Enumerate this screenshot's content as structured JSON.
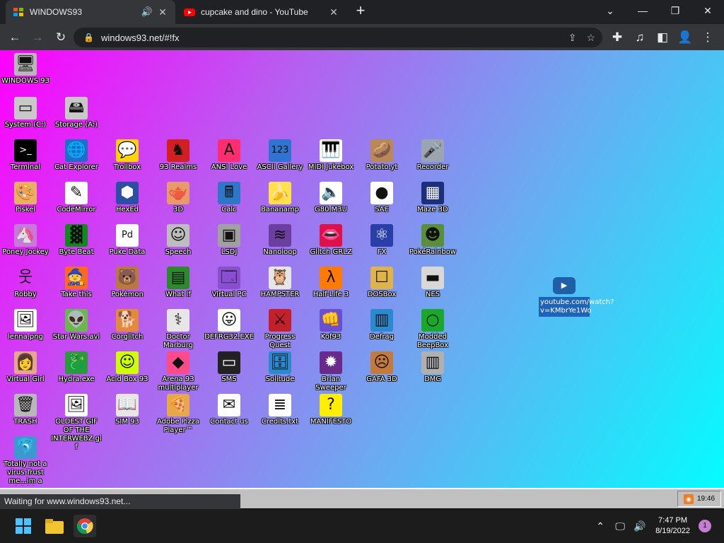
{
  "browser": {
    "tabs": [
      {
        "title": "WINDOWS93",
        "favicon": "windows93-favicon",
        "audio": true
      },
      {
        "title": "cupcake and dino - YouTube",
        "favicon": "youtube-favicon"
      }
    ],
    "url": "windows93.net/#!fx",
    "status_text": "Waiting for www.windows93.net..."
  },
  "desktop": {
    "icons": [
      {
        "label": "WINDOWS 93",
        "icon": "computer-icon",
        "glyph": "🖥",
        "bg": "#b8b8b8"
      },
      {
        "label": "System (C:)",
        "icon": "drive-icon",
        "glyph": "▭",
        "bg": "#c8c8c8"
      },
      {
        "label": "Storage (A:)",
        "icon": "floppy-drive-icon",
        "glyph": "🖴",
        "bg": "#c8c8c8"
      },
      {
        "label": "Terminal",
        "icon": "terminal-icon",
        "glyph": ">_",
        "bg": "#000000"
      },
      {
        "label": "Cat Explorer",
        "icon": "globe-cat-icon",
        "glyph": "🌐",
        "bg": "#1b6fc7"
      },
      {
        "label": "Trollbox",
        "icon": "troll-chat-icon",
        "glyph": "💬",
        "bg": "#ffd400"
      },
      {
        "label": "93 Realms",
        "icon": "realms-icon",
        "glyph": "♞",
        "bg": "#d21f1f"
      },
      {
        "label": "ANSI Love",
        "icon": "ansi-icon",
        "glyph": "A",
        "bg": "#ff2d6f"
      },
      {
        "label": "ASCII Gallery",
        "icon": "ascii-icon",
        "glyph": "123",
        "bg": "#2f74d0"
      },
      {
        "label": "MIDI Jukebox",
        "icon": "midi-icon",
        "glyph": "🎹",
        "bg": "#ffffff"
      },
      {
        "label": "Potato.yt",
        "icon": "potato-icon",
        "glyph": "🥔",
        "bg": "#b88a52"
      },
      {
        "label": "Recorder",
        "icon": "microphone-icon",
        "glyph": "🎤",
        "bg": "#9aa5b1"
      },
      {
        "label": "Piskel",
        "icon": "palette-icon",
        "glyph": "🎨",
        "bg": "#e8b060"
      },
      {
        "label": "CodeMirror",
        "icon": "codemirror-icon",
        "glyph": "✎",
        "bg": "#ffffff"
      },
      {
        "label": "HexEd",
        "icon": "cube-icon",
        "glyph": "⬢",
        "bg": "#2c4fa6"
      },
      {
        "label": "3D",
        "icon": "teapot-icon",
        "glyph": "🫖",
        "bg": "#e79a6a"
      },
      {
        "label": "Calc",
        "icon": "calculator-icon",
        "glyph": "🖩",
        "bg": "#2d77c8"
      },
      {
        "label": "Bananamp",
        "icon": "banana-icon",
        "glyph": "🍌",
        "bg": "#ffe24a"
      },
      {
        "label": "G80.M3U",
        "icon": "audio-file-icon",
        "glyph": "🔈",
        "bg": "#ffffff"
      },
      {
        "label": "SAE",
        "icon": "amiga-ball-icon",
        "glyph": "●",
        "bg": "#ffffff"
      },
      {
        "label": "Maze 3D",
        "icon": "maze-icon",
        "glyph": "▦",
        "bg": "#1d2f7a"
      },
      {
        "label": "Poney Jockey",
        "icon": "pony-icon",
        "glyph": "🦄",
        "bg": "#c47ad6"
      },
      {
        "label": "Byte Beat",
        "icon": "bytebeat-icon",
        "glyph": "▓",
        "bg": "#118a1c"
      },
      {
        "label": "Puke Data",
        "icon": "puke-data-icon",
        "glyph": "Pd",
        "bg": "#ffffff"
      },
      {
        "label": "Speech",
        "icon": "face-icon",
        "glyph": "☺",
        "bg": "#bdbdbd"
      },
      {
        "label": "LSDJ",
        "icon": "gameboy-icon",
        "glyph": "▣",
        "bg": "#a0a0a0"
      },
      {
        "label": "Nanoloop",
        "icon": "nanoloop-icon",
        "glyph": "≋",
        "bg": "#6b3fa0"
      },
      {
        "label": "Glitch GRLZ",
        "icon": "lips-icon",
        "glyph": "👄",
        "bg": "#e0114a"
      },
      {
        "label": "FX",
        "icon": "atom-icon",
        "glyph": "⚛",
        "bg": "#2a3ea8"
      },
      {
        "label": "PokéRainbow",
        "icon": "pokerainbow-icon",
        "glyph": "☻",
        "bg": "#5a8f3a"
      },
      {
        "label": "Robby",
        "icon": "stickman-icon",
        "glyph": "웃",
        "bg": "transparent"
      },
      {
        "label": "Take this",
        "icon": "take-this-icon",
        "glyph": "🧙",
        "bg": "#ff6a1a"
      },
      {
        "label": "Pokémon",
        "icon": "pokemon-icon",
        "glyph": "🐻",
        "bg": "#b87a3a"
      },
      {
        "label": "What If",
        "icon": "what-if-icon",
        "glyph": "▤",
        "bg": "#2b8a2b"
      },
      {
        "label": "Virtual PC",
        "icon": "virtual-pc-icon",
        "glyph": "🗔",
        "bg": "#8a4fd0"
      },
      {
        "label": "HAMPSTER",
        "icon": "owl-icon",
        "glyph": "🦉",
        "bg": "#e6e6e6"
      },
      {
        "label": "Half-Life 3",
        "icon": "half-life-icon",
        "glyph": "λ",
        "bg": "#ff7a00"
      },
      {
        "label": "DOSBox",
        "icon": "dosbox-icon",
        "glyph": "☐",
        "bg": "#e0b24a"
      },
      {
        "label": "NES",
        "icon": "nes-icon",
        "glyph": "▬",
        "bg": "#d8d8d8"
      },
      {
        "label": "lenna.png",
        "icon": "image-file-icon",
        "glyph": "🖼",
        "bg": "#ffffff"
      },
      {
        "label": "Star Wars.avi",
        "icon": "yoda-icon",
        "glyph": "👽",
        "bg": "#6bb84a"
      },
      {
        "label": "Corglitch",
        "icon": "corgi-icon",
        "glyph": "🐕",
        "bg": "#e38a3a"
      },
      {
        "label": "Doctor Marburg",
        "icon": "doctor-icon",
        "glyph": "⚕",
        "bg": "#e6e6e6"
      },
      {
        "label": "DEFRG32.EXE",
        "icon": "defrag-monitor-icon",
        "glyph": "😛",
        "bg": "#ffffff"
      },
      {
        "label": "Progress Quest",
        "icon": "swords-icon",
        "glyph": "⚔",
        "bg": "#c4202a"
      },
      {
        "label": "Kof93",
        "icon": "fighter-icon",
        "glyph": "👊",
        "bg": "#6a4fd0"
      },
      {
        "label": "Defrag",
        "icon": "defrag-icon",
        "glyph": "▥",
        "bg": "#2a8ad0"
      },
      {
        "label": "Modded BeepBox",
        "icon": "beepbox-icon",
        "glyph": "○",
        "bg": "#1aa82a"
      },
      {
        "label": "Virtual Girl",
        "icon": "virtual-girl-icon",
        "glyph": "👩",
        "bg": "#e6a68a"
      },
      {
        "label": "Hydra.exe",
        "icon": "hydra-icon",
        "glyph": "🐉",
        "bg": "#2a9a3a"
      },
      {
        "label": "Acid Box 93",
        "icon": "smiley-icon",
        "glyph": "☺",
        "bg": "#cfff00"
      },
      {
        "label": "Arena 93 multiplayer",
        "icon": "arena-cube-icon",
        "glyph": "◆",
        "bg": "#ff4a8a"
      },
      {
        "label": "SMS",
        "icon": "sms-console-icon",
        "glyph": "▭",
        "bg": "#222222"
      },
      {
        "label": "Solitude",
        "icon": "solitude-icon",
        "glyph": "🗄",
        "bg": "#2a8ad0"
      },
      {
        "label": "Brian Sweeper",
        "icon": "mine-icon",
        "glyph": "✹",
        "bg": "#6a2a8a"
      },
      {
        "label": "GAFA 3D",
        "icon": "doom-face-icon",
        "glyph": "☹",
        "bg": "#c47a3a"
      },
      {
        "label": "DMG",
        "icon": "dmg-icon",
        "glyph": "▥",
        "bg": "#b0b0b0"
      },
      {
        "label": "TRASH",
        "icon": "trash-icon",
        "glyph": "🗑",
        "bg": "#b8b8b8"
      },
      {
        "label": "OLDEST GIF OF THE INTERWEBZ.gif",
        "icon": "gif-file-icon",
        "glyph": "🖼",
        "bg": "#ffffff"
      },
      {
        "label": "SIM 93",
        "icon": "sim-icon",
        "glyph": "📖",
        "bg": "#e6e6e6"
      },
      {
        "label": "Adobe Pizza Player™",
        "icon": "pizza-icon",
        "glyph": "🍕",
        "bg": "#e6a84a"
      },
      {
        "label": "Contact us",
        "icon": "contact-icon",
        "glyph": "✉",
        "bg": "#ffffff"
      },
      {
        "label": "Credits.txt",
        "icon": "text-file-icon",
        "glyph": "≣",
        "bg": "#ffffff"
      },
      {
        "label": "MANIFESTO",
        "icon": "question-icon",
        "glyph": "?",
        "bg": "#ffee00"
      },
      {
        "label": "Totally not a virus.Trust me...im a dolphin",
        "icon": "dolphin-icon",
        "glyph": "🐬",
        "bg": "#3a9ad0"
      }
    ],
    "youtube_shortcut": {
      "label": "youtube.com/watch?v=KMbrYe1Wo",
      "icon": "youtube-link-icon"
    }
  },
  "win93_taskbar": {
    "clock": "19:46",
    "rss_icon": "rss-icon"
  },
  "windows_taskbar": {
    "apps": [
      {
        "name": "start-button",
        "icon": "windows-logo-icon"
      },
      {
        "name": "file-explorer",
        "icon": "folder-icon"
      },
      {
        "name": "chrome",
        "icon": "chrome-icon"
      }
    ],
    "time": "7:47 PM",
    "date": "8/19/2022",
    "notifications": "1"
  },
  "colors": {
    "chrome_dark": "#202124",
    "chrome_toolbar": "#35363a",
    "youtube_red": "#ff0000",
    "windows_blue": "#0078d4"
  }
}
